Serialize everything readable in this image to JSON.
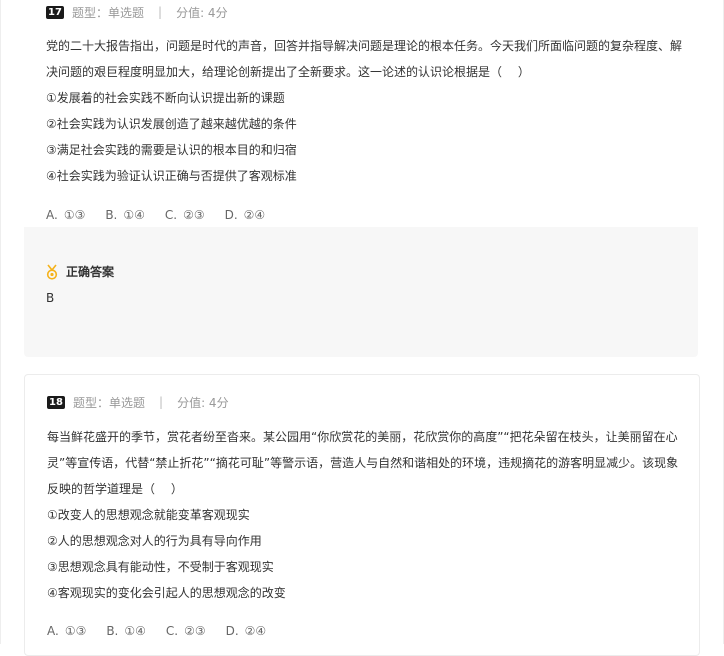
{
  "questions": [
    {
      "number": "17",
      "type_label": "题型：",
      "type_value": "单选题",
      "separator": "|",
      "score": "分值: 4分",
      "stem": "党的二十大报告指出，问题是时代的声音，回答并指导解决问题是理论的根本任务。今天我们所面临问题的复杂程度、解决问题的艰巨程度明显加大，给理论创新提出了全新要求。这一论述的认识论根据是（　 ）",
      "statements": [
        "①发展着的社会实践不断向认识提出新的课题",
        "②社会实践为认识发展创造了越来越优越的条件",
        "③满足社会实践的需要是认识的根本目的和归宿",
        "④社会实践为验证认识正确与否提供了客观标准"
      ],
      "options": [
        {
          "letter": "A.",
          "value": "①③"
        },
        {
          "letter": "B.",
          "value": "①④"
        },
        {
          "letter": "C.",
          "value": "②③"
        },
        {
          "letter": "D.",
          "value": "②④"
        }
      ],
      "answer_title": "正确答案",
      "answer_value": "B"
    },
    {
      "number": "18",
      "type_label": "题型：",
      "type_value": "单选题",
      "separator": "|",
      "score": "分值: 4分",
      "stem": "每当鲜花盛开的季节，赏花者纷至沓来。某公园用“你欣赏花的美丽，花欣赏你的高度”“把花朵留在枝头，让美丽留在心灵”等宣传语，代替“禁止折花”“摘花可耻”等警示语，营造人与自然和谐相处的环境，违规摘花的游客明显减少。该现象反映的哲学道理是（　 ）",
      "statements": [
        "①改变人的思想观念就能变革客观现实",
        "②人的思想观念对人的行为具有导向作用",
        "③思想观念具有能动性，不受制于客观现实",
        "④客观现实的变化会引起人的思想观念的改变"
      ],
      "options": [
        {
          "letter": "A.",
          "value": "①③"
        },
        {
          "letter": "B.",
          "value": "①④"
        },
        {
          "letter": "C.",
          "value": "②③"
        },
        {
          "letter": "D.",
          "value": "②④"
        }
      ]
    }
  ],
  "colors": {
    "answer_bg": "#f7f7f7",
    "medal": "#f5b21b",
    "muted_text": "#999999",
    "body_text": "#333333"
  },
  "icons": {
    "question_badge": "question-number-badge",
    "answer": "medal-icon"
  }
}
